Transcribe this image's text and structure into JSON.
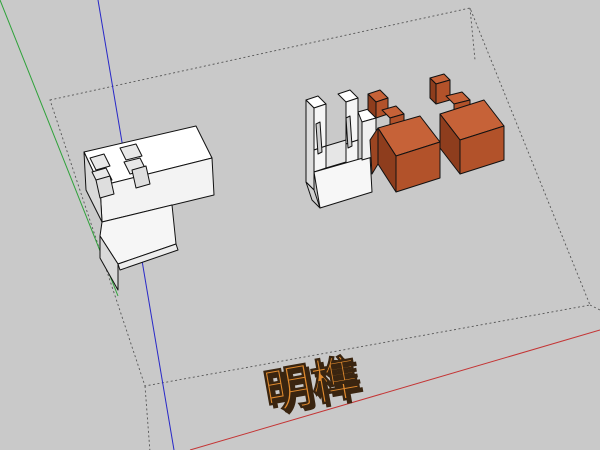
{
  "app": {
    "type": "3d-modeling-viewport",
    "background_color": "#c9c9c9"
  },
  "model": {
    "label_text": "明榫",
    "label_color": "#e08a2e",
    "label_outline_color": "#3a2510",
    "left_piece": {
      "color": "#ffffff",
      "shade_color": "#d9d9d9"
    },
    "right_white_piece": {
      "color": "#ffffff",
      "shade_color": "#dcdcdc"
    },
    "right_brown_pieces": {
      "color": "#b2522a",
      "shade_color": "#8e3d1d",
      "top_color": "#c66238"
    }
  },
  "axes": {
    "green_axis_color": "#2fa23a",
    "blue_axis_color": "#2828c8",
    "red_axis_color": "#c43434",
    "bounding_box": "dotted"
  }
}
